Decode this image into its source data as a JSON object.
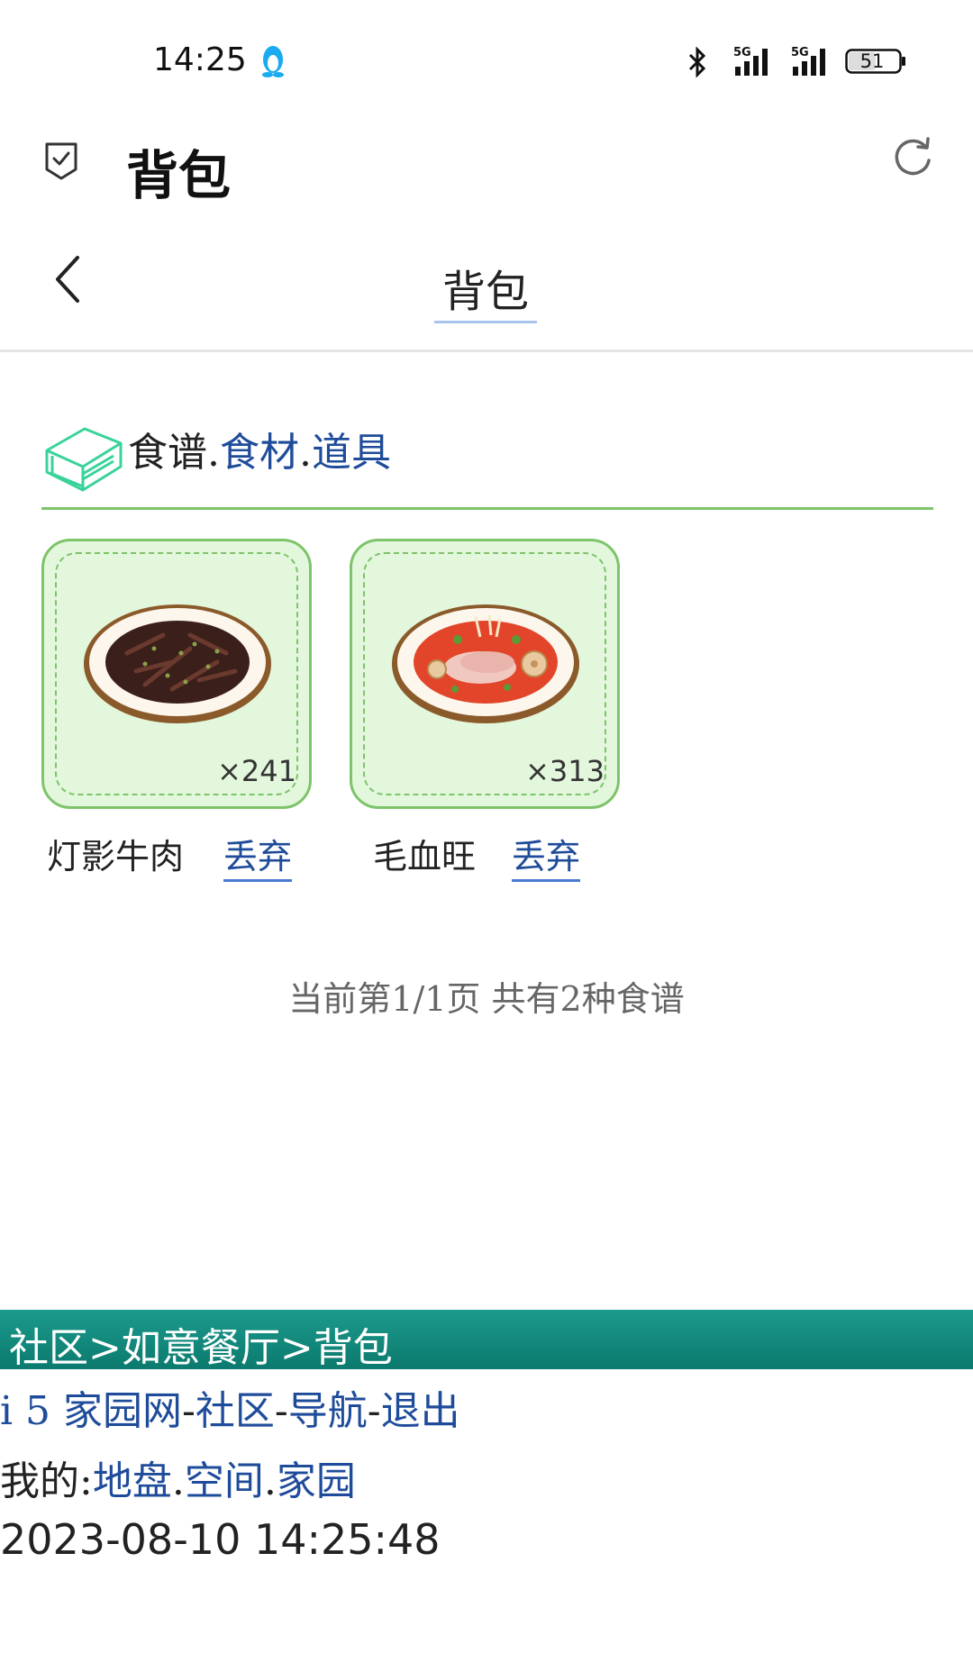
{
  "status_bar": {
    "time": "14:25",
    "network_1": "5G",
    "network_2": "5G",
    "battery": "51"
  },
  "app_bar": {
    "title": "背包"
  },
  "page_header": {
    "title": "背包"
  },
  "section_tabs": {
    "current": "食谱",
    "sep1": ".",
    "link1": "食材",
    "sep2": ".",
    "link2": "道具"
  },
  "items": [
    {
      "name": "灯影牛肉",
      "count": "×241",
      "discard_label": "丢弃"
    },
    {
      "name": "毛血旺",
      "count": "×313",
      "discard_label": "丢弃"
    }
  ],
  "pagination": {
    "text": "当前第1/1页 共有2种食谱"
  },
  "footer": {
    "breadcrumb": "社区>如意餐厅>背包",
    "nav": {
      "home": "i 5 家园网",
      "sep1": "-",
      "community": "社区",
      "sep2": "-",
      "navigation": "导航",
      "sep3": "-",
      "logout": "退出"
    },
    "mine": {
      "label": "我的:",
      "land": "地盘",
      "sep1": ".",
      "space": "空间",
      "sep2": ".",
      "home": "家园"
    },
    "timestamp": "2023-08-10 14:25:48"
  },
  "colors": {
    "accent_green": "#7dc46a",
    "card_bg": "#e3f7dd",
    "link_blue": "#1f4c9a",
    "footer_teal": "#0c7a6e"
  }
}
